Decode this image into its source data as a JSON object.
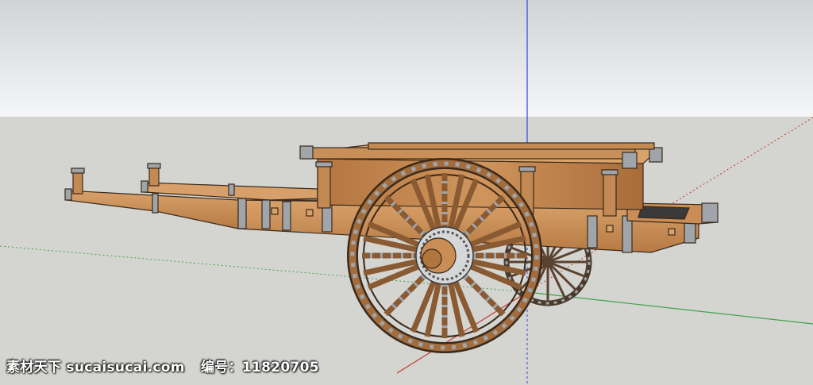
{
  "scene": {
    "sky_color_top": "#cfd3d5",
    "sky_color_bottom": "#f4f5f6",
    "ground_color": "#d3d4d0",
    "axis_red": "#c0392b",
    "axis_green": "#3fa34d",
    "axis_blue": "#3344dd",
    "wood_color": "#c98d55",
    "iron_color": "#9fa5aa"
  },
  "watermark": {
    "site_label": "素材天下 sucaisucai.com",
    "id_label": "编号：11820705"
  }
}
